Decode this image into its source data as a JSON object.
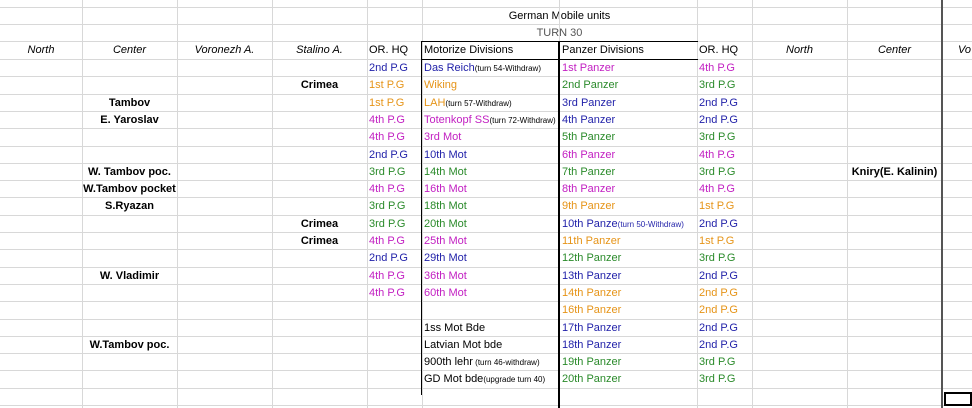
{
  "title": "German Mobile units",
  "turn": "TURN 30",
  "colors": {
    "navy": "#1f1fa8",
    "orange": "#e69418",
    "green": "#2a8a2a",
    "magenta": "#c21fc2",
    "black": "#000000"
  },
  "headers": [
    "North",
    "Center",
    "Voronezh A.",
    "Stalino A.",
    "OR. HQ",
    "Motorize Divisions",
    "Panzer Divisions",
    "OR. HQ",
    "North",
    "Center",
    "Vo"
  ],
  "rows": [
    {
      "center": "",
      "stalino": "",
      "mhq": {
        "t": "2nd P.G",
        "c": "navy"
      },
      "mot": {
        "t": "Das Reich",
        "s": "(turn 54-Withdraw)",
        "c": "navy"
      },
      "pz": {
        "t": "1st Panzer",
        "s": "",
        "c": "magenta"
      },
      "phq": {
        "t": "4th P.G",
        "c": "magenta"
      },
      "center2": ""
    },
    {
      "center": "",
      "stalino": "Crimea",
      "mhq": {
        "t": "1st P.G",
        "c": "orange"
      },
      "mot": {
        "t": "Wiking",
        "s": "",
        "c": "orange"
      },
      "pz": {
        "t": "2nd Panzer",
        "s": "",
        "c": "green"
      },
      "phq": {
        "t": "3rd P.G",
        "c": "green"
      },
      "center2": ""
    },
    {
      "center": "Tambov",
      "stalino": "",
      "mhq": {
        "t": "1st P.G",
        "c": "orange"
      },
      "mot": {
        "t": "LAH",
        "s": "(turn 57-Withdraw)",
        "c": "orange"
      },
      "pz": {
        "t": "3rd Panzer",
        "s": "",
        "c": "navy"
      },
      "phq": {
        "t": "2nd P.G",
        "c": "navy"
      },
      "center2": ""
    },
    {
      "center": "E. Yaroslav",
      "stalino": "",
      "mhq": {
        "t": "4th P.G",
        "c": "magenta"
      },
      "mot": {
        "t": "Totenkopf SS",
        "s": "(turn 72-Withdraw)",
        "c": "magenta"
      },
      "pz": {
        "t": "4th Panzer",
        "s": "",
        "c": "navy"
      },
      "phq": {
        "t": "2nd P.G",
        "c": "navy"
      },
      "center2": ""
    },
    {
      "center": "",
      "stalino": "",
      "mhq": {
        "t": "4th P.G",
        "c": "magenta"
      },
      "mot": {
        "t": "3rd Mot",
        "s": "",
        "c": "magenta"
      },
      "pz": {
        "t": "5th Panzer",
        "s": "",
        "c": "green"
      },
      "phq": {
        "t": "3rd P.G",
        "c": "green"
      },
      "center2": ""
    },
    {
      "center": "",
      "stalino": "",
      "mhq": {
        "t": "2nd P.G",
        "c": "navy"
      },
      "mot": {
        "t": "10th Mot",
        "s": "",
        "c": "navy"
      },
      "pz": {
        "t": "6th Panzer",
        "s": "",
        "c": "magenta"
      },
      "phq": {
        "t": "4th P.G",
        "c": "magenta"
      },
      "center2": ""
    },
    {
      "center": "W. Tambov poc.",
      "stalino": "",
      "mhq": {
        "t": "3rd P.G",
        "c": "green"
      },
      "mot": {
        "t": "14th Mot",
        "s": "",
        "c": "green"
      },
      "pz": {
        "t": "7th Panzer",
        "s": "",
        "c": "green"
      },
      "phq": {
        "t": "3rd P.G",
        "c": "green"
      },
      "center2": "Kniry(E. Kalinin)"
    },
    {
      "center": "W.Tambov pocket",
      "stalino": "",
      "mhq": {
        "t": "4th P.G",
        "c": "magenta"
      },
      "mot": {
        "t": "16th Mot",
        "s": "",
        "c": "magenta"
      },
      "pz": {
        "t": "8th Panzer",
        "s": "",
        "c": "magenta"
      },
      "phq": {
        "t": "4th P.G",
        "c": "magenta"
      },
      "center2": ""
    },
    {
      "center": "S.Ryazan",
      "stalino": "",
      "mhq": {
        "t": "3rd P.G",
        "c": "green"
      },
      "mot": {
        "t": "18th Mot",
        "s": "",
        "c": "green"
      },
      "pz": {
        "t": "9th Panzer",
        "s": "",
        "c": "orange"
      },
      "phq": {
        "t": "1st P.G",
        "c": "orange"
      },
      "center2": ""
    },
    {
      "center": "",
      "stalino": "Crimea",
      "mhq": {
        "t": "3rd P.G",
        "c": "green"
      },
      "mot": {
        "t": "20th Mot",
        "s": "",
        "c": "green"
      },
      "pz": {
        "t": "10th Panze",
        "s": "(turn 50-Withdraw)",
        "c": "navy"
      },
      "phq": {
        "t": "2nd P.G",
        "c": "navy"
      },
      "center2": ""
    },
    {
      "center": "",
      "stalino": "Crimea",
      "mhq": {
        "t": "4th P.G",
        "c": "magenta"
      },
      "mot": {
        "t": "25th Mot",
        "s": "",
        "c": "magenta"
      },
      "pz": {
        "t": "11th Panzer",
        "s": "",
        "c": "orange"
      },
      "phq": {
        "t": "1st P.G",
        "c": "orange"
      },
      "center2": ""
    },
    {
      "center": "",
      "stalino": "",
      "mhq": {
        "t": "2nd P.G",
        "c": "navy"
      },
      "mot": {
        "t": "29th Mot",
        "s": "",
        "c": "navy"
      },
      "pz": {
        "t": "12th Panzer",
        "s": "",
        "c": "green"
      },
      "phq": {
        "t": "3rd P.G",
        "c": "green"
      },
      "center2": ""
    },
    {
      "center": "W. Vladimir",
      "stalino": "",
      "mhq": {
        "t": "4th P.G",
        "c": "magenta"
      },
      "mot": {
        "t": "36th Mot",
        "s": "",
        "c": "magenta"
      },
      "pz": {
        "t": "13th Panzer",
        "s": "",
        "c": "navy"
      },
      "phq": {
        "t": "2nd P.G",
        "c": "navy"
      },
      "center2": ""
    },
    {
      "center": "",
      "stalino": "",
      "mhq": {
        "t": "4th P.G",
        "c": "magenta"
      },
      "mot": {
        "t": "60th Mot",
        "s": "",
        "c": "magenta"
      },
      "pz": {
        "t": "14th Panzer",
        "s": "",
        "c": "orange"
      },
      "phq": {
        "t": "2nd P.G",
        "c": "orange"
      },
      "center2": ""
    },
    {
      "center": "",
      "stalino": "",
      "mhq": {
        "t": "",
        "c": "black"
      },
      "mot": {
        "t": "",
        "s": "",
        "c": "black"
      },
      "pz": {
        "t": "16th Panzer",
        "s": "",
        "c": "orange"
      },
      "phq": {
        "t": "2nd P.G",
        "c": "orange"
      },
      "center2": ""
    },
    {
      "center": "",
      "stalino": "",
      "mhq": {
        "t": "",
        "c": "black"
      },
      "mot": {
        "t": "1ss Mot Bde",
        "s": "",
        "c": "black"
      },
      "pz": {
        "t": "17th Panzer",
        "s": "",
        "c": "navy"
      },
      "phq": {
        "t": "2nd P.G",
        "c": "navy"
      },
      "center2": ""
    },
    {
      "center": "W.Tambov poc.",
      "stalino": "",
      "mhq": {
        "t": "",
        "c": "black"
      },
      "mot": {
        "t": "Latvian Mot bde",
        "s": "",
        "c": "black"
      },
      "pz": {
        "t": "18th Panzer",
        "s": "",
        "c": "navy"
      },
      "phq": {
        "t": "2nd P.G",
        "c": "navy"
      },
      "center2": ""
    },
    {
      "center": "",
      "stalino": "",
      "mhq": {
        "t": "",
        "c": "black"
      },
      "mot": {
        "t": "900th lehr",
        "s": " (turn 46-withdraw)",
        "c": "black"
      },
      "pz": {
        "t": "19th Panzer",
        "s": "",
        "c": "green"
      },
      "phq": {
        "t": "3rd P.G",
        "c": "green"
      },
      "center2": ""
    },
    {
      "center": "",
      "stalino": "",
      "mhq": {
        "t": "",
        "c": "black"
      },
      "mot": {
        "t": "GD Mot bde",
        "s": "(upgrade turn 40)",
        "c": "black"
      },
      "pz": {
        "t": "20th Panzer",
        "s": "",
        "c": "green"
      },
      "phq": {
        "t": "3rd P.G",
        "c": "green"
      },
      "center2": ""
    }
  ]
}
